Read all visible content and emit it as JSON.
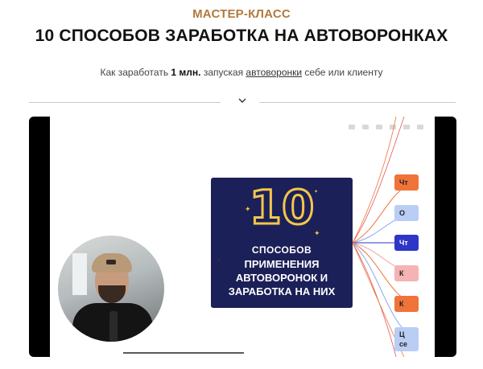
{
  "header": {
    "eyebrow": "МАСТЕР-КЛАСС",
    "title": "10 СПОСОБОВ ЗАРАБОТКА НА АВТОВОРОНКАХ",
    "subtitle_pre": "Как заработать ",
    "subtitle_bold": "1 млн.",
    "subtitle_mid": " запуская ",
    "subtitle_link": "автоворонки",
    "subtitle_post": " себе или клиенту"
  },
  "video": {
    "card": {
      "number": "10",
      "line1": "СПОСОБОВ",
      "line2": "ПРИМЕНЕНИЯ",
      "line3": "АВТОВОРОНОК И",
      "line4": "ЗАРАБОТКА НА НИХ"
    },
    "tags": [
      {
        "label": "Чт",
        "color": "#f0733a"
      },
      {
        "label": "О",
        "color": "#b9cdf5"
      },
      {
        "label": "Чт",
        "color": "#2e36c8"
      },
      {
        "label": "К",
        "color": "#f5b3b3"
      },
      {
        "label": "К",
        "color": "#f0733a"
      },
      {
        "label": "Ц\nсе",
        "color": "#b9cdf5"
      }
    ],
    "colors": {
      "card_bg": "#1c2058",
      "accent": "#f3c64c"
    }
  }
}
